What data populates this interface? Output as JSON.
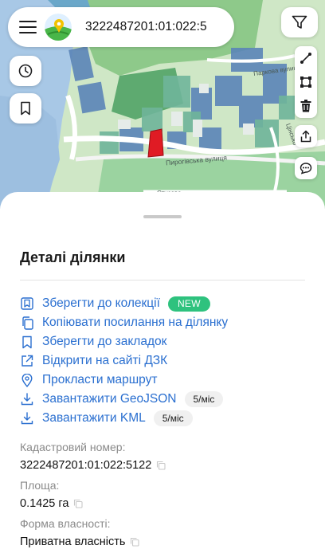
{
  "search": {
    "value": "3222487201:01:022:5"
  },
  "map": {
    "streets": [
      "Паркова вулиця",
      "Пирогівська вулиця",
      "Стусова",
      "Цінсько"
    ]
  },
  "icons": {
    "menu": "hamburger-icon",
    "logo": "app-logo",
    "filter": "filter-icon",
    "history": "clock-icon",
    "bookmarks": "bookmark-icon",
    "ruler": "ruler-line-icon",
    "polygon": "polygon-icon",
    "trash": "trash-icon",
    "share": "share-icon",
    "chat": "chat-icon"
  },
  "details": {
    "title": "Деталі ділянки",
    "actions": [
      {
        "label": "Зберегти до колекції",
        "icon": "collection-icon",
        "badge": "NEW"
      },
      {
        "label": "Копіювати посилання на ділянку",
        "icon": "copy-link-icon"
      },
      {
        "label": "Зберегти до закладок",
        "icon": "bookmark-icon"
      },
      {
        "label": "Відкрити на сайті ДЗК",
        "icon": "external-link-icon"
      },
      {
        "label": "Прокласти маршрут",
        "icon": "location-pin-icon"
      },
      {
        "label": "Завантажити GeoJSON",
        "icon": "download-icon",
        "quota": "5/міс"
      },
      {
        "label": "Завантажити KML",
        "icon": "download-icon",
        "quota": "5/міс"
      }
    ],
    "fields": [
      {
        "label": "Кадастровий номер:",
        "value": "3222487201:01:022:5122"
      },
      {
        "label": "Площа:",
        "value": "0.1425 га"
      },
      {
        "label": "Форма власності:",
        "value": "Приватна власність"
      }
    ]
  },
  "colors": {
    "link": "#2a6fd0",
    "badge_new": "#2ec27e",
    "parcel_selected": "#e01b24"
  }
}
